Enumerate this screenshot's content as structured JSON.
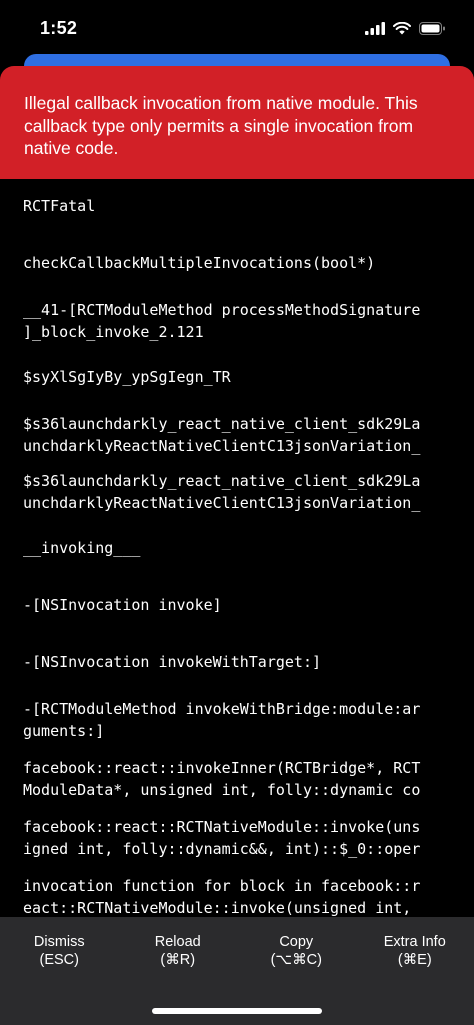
{
  "status_bar": {
    "time": "1:52",
    "icons": [
      "cellular-signal-icon",
      "wifi-icon",
      "battery-icon"
    ]
  },
  "error": {
    "message": "Illegal callback invocation from native module. This callback type only permits a single invocation from native code.",
    "banner_color": "#d22027"
  },
  "stack_frames": [
    [
      "RCTFatal"
    ],
    [
      "checkCallbackMultipleInvocations(bool*)"
    ],
    [
      "__41-[RCTModuleMethod processMethodSignature",
      "]_block_invoke_2.121"
    ],
    [
      "$syXlSgIyBy_ypSgIegn_TR"
    ],
    [
      "$s36launchdarkly_react_native_client_sdk29La",
      "unchdarklyReactNativeClientC13jsonVariation_"
    ],
    [
      "$s36launchdarkly_react_native_client_sdk29La",
      "unchdarklyReactNativeClientC13jsonVariation_"
    ],
    [
      "__invoking___"
    ],
    [
      "-[NSInvocation invoke]"
    ],
    [
      "-[NSInvocation invokeWithTarget:]"
    ],
    [
      "-[RCTModuleMethod invokeWithBridge:module:ar",
      "guments:]"
    ],
    [
      "facebook::react::invokeInner(RCTBridge*, RCT",
      "ModuleData*, unsigned int, folly::dynamic co"
    ],
    [
      "facebook::react::RCTNativeModule::invoke(uns",
      "igned int, folly::dynamic&&, int)::$_0::oper"
    ],
    [
      "invocation function for block in facebook::r",
      "eact::RCTNativeModule::invoke(unsigned int,"
    ]
  ],
  "actions": [
    {
      "label": "Dismiss",
      "shortcut": "(ESC)"
    },
    {
      "label": "Reload",
      "shortcut": "(⌘R)"
    },
    {
      "label": "Copy",
      "shortcut": "(⌥⌘C)"
    },
    {
      "label": "Extra Info",
      "shortcut": "(⌘E)"
    }
  ]
}
